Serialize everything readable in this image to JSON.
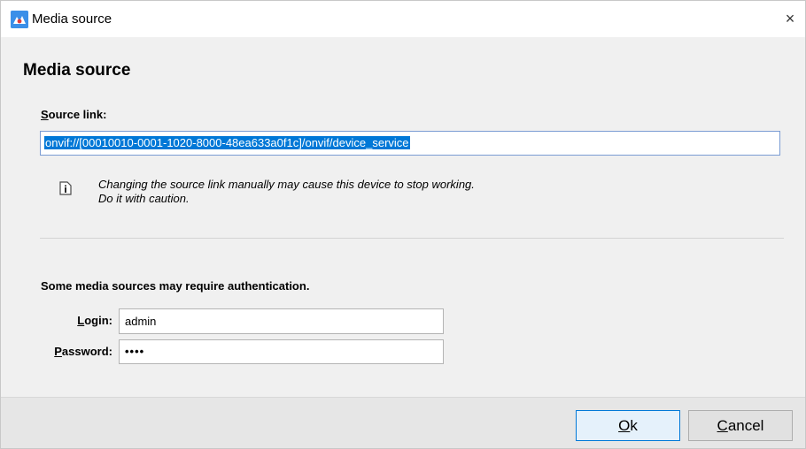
{
  "window": {
    "title": "Media source",
    "close_glyph": "×",
    "app_icon": "app-logo-icon"
  },
  "heading": "Media source",
  "source": {
    "label_mnemonic": "S",
    "label_rest": "ource link:",
    "value": "onvif://[00010010-0001-1020-8000-48ea633a0f1c]/onvif/device_service"
  },
  "warning": {
    "icon": "info-icon",
    "line1": "Changing the source link manually may cause this device to stop working.",
    "line2": "Do it with caution."
  },
  "auth": {
    "note": "Some media sources may require authentication.",
    "login_label_mnemonic": "L",
    "login_label_rest": "ogin:",
    "login_value": "admin",
    "password_label_mnemonic": "P",
    "password_label_rest": "assword:",
    "password_value": "••••"
  },
  "buttons": {
    "ok_mnemonic": "O",
    "ok_rest": "k",
    "cancel_mnemonic": "C",
    "cancel_rest": "ancel"
  },
  "colors": {
    "selection": "#0078d7",
    "window_bg": "#f0f0f0",
    "footer_bg": "#e6e6e6"
  }
}
